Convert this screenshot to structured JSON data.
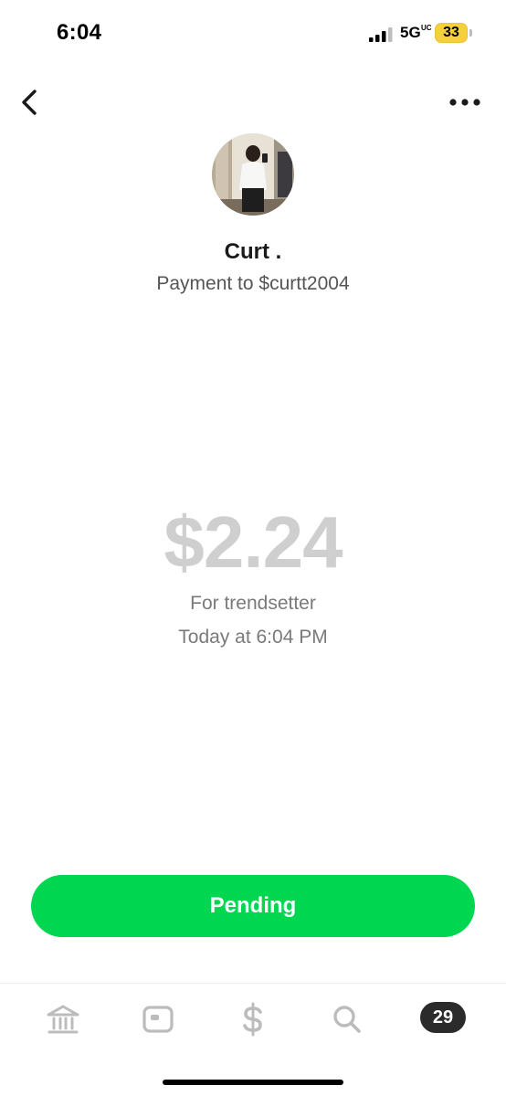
{
  "status_bar": {
    "time": "6:04",
    "network": "5G",
    "network_superscript": "UC",
    "battery": "33"
  },
  "header": {
    "back_icon": "chevron-left-icon",
    "more_icon": "ellipsis-icon"
  },
  "recipient": {
    "name": "Curt .",
    "subtitle": "Payment to $curtt2004"
  },
  "payment": {
    "amount": "$2.24",
    "note": "For trendsetter",
    "timestamp": "Today at 6:04 PM"
  },
  "status_button": {
    "label": "Pending",
    "color": "#00d64f"
  },
  "tab_bar": {
    "tabs": [
      {
        "icon": "bank-icon"
      },
      {
        "icon": "card-icon"
      },
      {
        "icon": "dollar-icon"
      },
      {
        "icon": "search-icon"
      }
    ],
    "activity_badge": "29"
  },
  "colors": {
    "accent": "#00d64f",
    "amount": "#cfcfcf",
    "battery": "#f5cf3c"
  }
}
